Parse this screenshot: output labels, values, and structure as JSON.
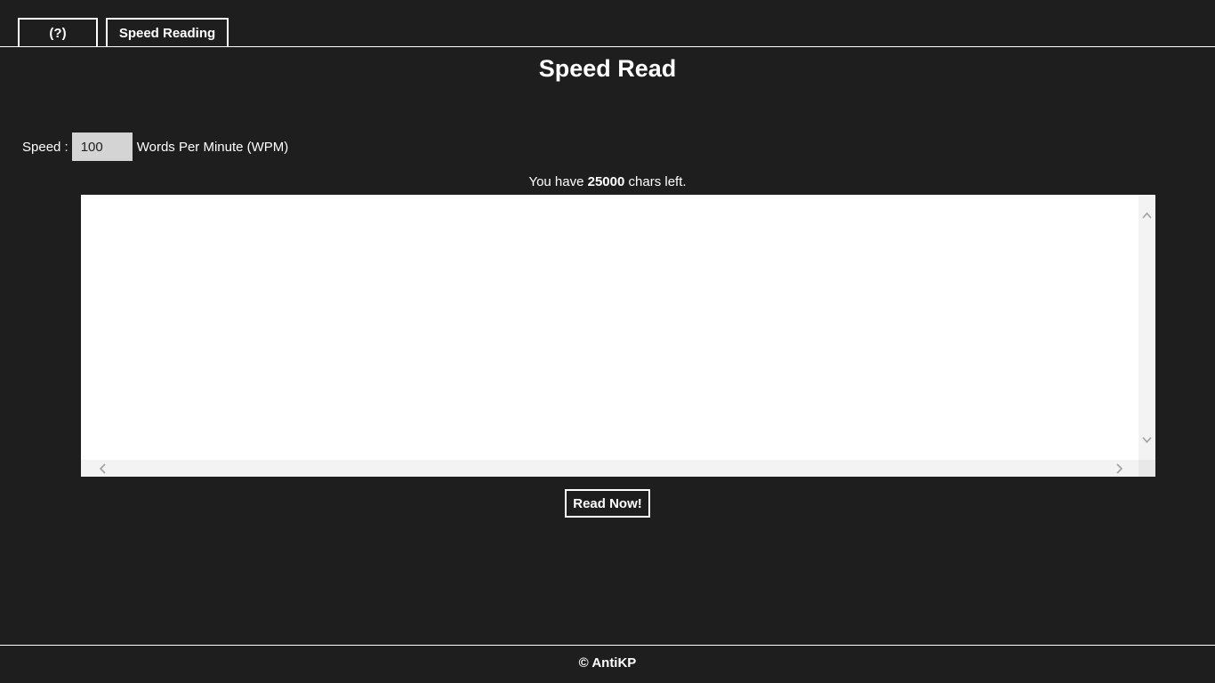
{
  "tabs": {
    "help_label": "(?)",
    "speed_reading_label": "Speed Reading"
  },
  "page_title": "Speed Read",
  "speed": {
    "label": "Speed :",
    "value": "100",
    "unit_label": "Words Per Minute (WPM)"
  },
  "chars_left": {
    "prefix": "You have",
    "count": "25000",
    "suffix": "chars left."
  },
  "text_input": {
    "value": ""
  },
  "read_button_label": "Read Now!",
  "footer": "© AntiKP",
  "icons": {
    "scroll_up": "chevron-up-icon",
    "scroll_down": "chevron-down-icon",
    "scroll_left": "chevron-left-icon",
    "scroll_right": "chevron-right-icon"
  },
  "colors": {
    "background": "#1e1e1e",
    "foreground": "#ffffff",
    "input_background": "#d4d4d4"
  }
}
